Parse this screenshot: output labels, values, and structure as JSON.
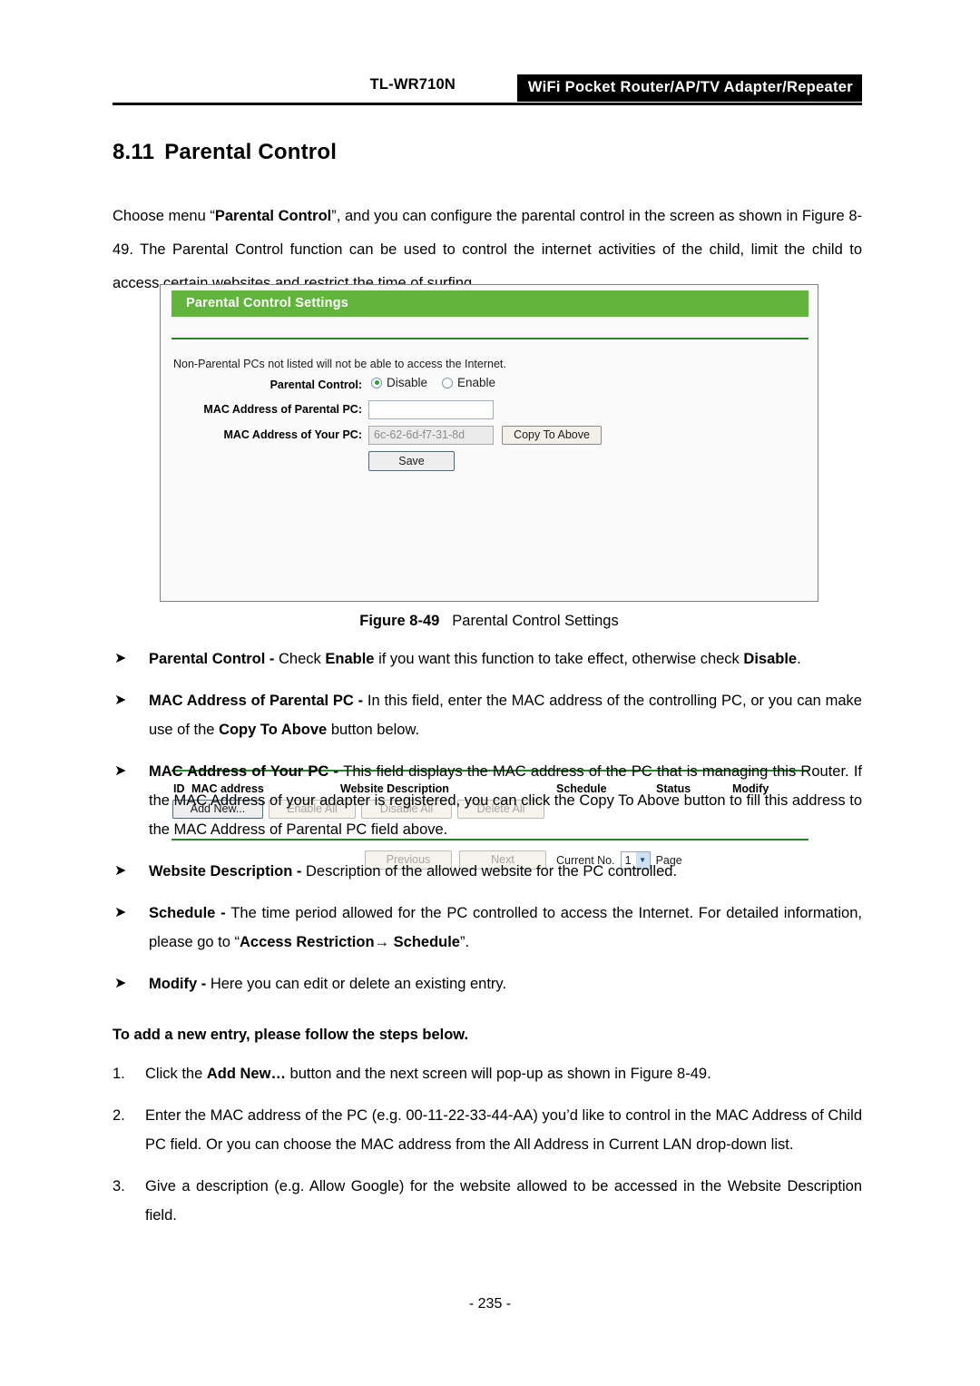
{
  "header": {
    "model": "TL-WR710N",
    "product": "WiFi Pocket Router/AP/TV Adapter/Repeater"
  },
  "section": {
    "number": "8.11",
    "title": "Parental Control"
  },
  "intro": {
    "part1": "Choose menu “",
    "bold1": "Parental Control",
    "part2": "”, and you can configure the parental control in the screen as shown in Figure 8-49. The Parental Control function can be used to control the internet activities of the child, limit the child to access certain websites and restrict the time of surfing."
  },
  "figure": {
    "caption_label": "Figure 8-49",
    "caption_text": "Parental Control Settings",
    "ui": {
      "title": "Parental Control Settings",
      "note": "Non-Parental PCs not listed will not be able to access the Internet.",
      "labels": {
        "parental_control": "Parental Control:",
        "mac_parental_pc": "MAC Address of Parental PC:",
        "mac_your_pc": "MAC Address of Your PC:"
      },
      "radios": {
        "disable": "Disable",
        "enable": "Enable",
        "selected": "Disable"
      },
      "inputs": {
        "mac_parental_value": "",
        "mac_parental_placeholder": "",
        "mac_your_pc_value": "6c-62-6d-f7-31-8d"
      },
      "buttons": {
        "copy_to_above": "Copy To Above",
        "save": "Save",
        "add_new": "Add New...",
        "enable_all": "Enable All",
        "disable_all": "Disable All",
        "delete_all": "Delete All",
        "previous": "Previous",
        "next": "Next"
      },
      "table_headers": {
        "id": "ID",
        "mac_address": "MAC address",
        "website_description": "Website Description",
        "schedule": "Schedule",
        "status": "Status",
        "modify": "Modify"
      },
      "table_rows": [],
      "pagination": {
        "prefix": "Current No.",
        "value": "1",
        "suffix": "Page",
        "options": [
          "1"
        ]
      },
      "colors": {
        "title_bar": "#62b53c",
        "rule": "#2f7d32",
        "radio_selected": "#2aa531"
      }
    }
  },
  "bullets": [
    {
      "marker": "➤",
      "segments": [
        {
          "t": "Parental Control - ",
          "b": true
        },
        {
          "t": "Check ",
          "b": false
        },
        {
          "t": "Enable",
          "b": true
        },
        {
          "t": " if you want this function to take effect, otherwise check ",
          "b": false
        },
        {
          "t": "Disable",
          "b": true
        },
        {
          "t": ".",
          "b": false
        }
      ]
    },
    {
      "marker": "➤",
      "segments": [
        {
          "t": "MAC Address of Parental PC - ",
          "b": true
        },
        {
          "t": "In this field, enter the MAC address of the controlling PC, or you can make use of the ",
          "b": false
        },
        {
          "t": "Copy To Above",
          "b": true
        },
        {
          "t": " button below.",
          "b": false
        }
      ]
    },
    {
      "marker": "➤",
      "segments": [
        {
          "t": "MAC Address of Your PC - ",
          "b": true
        },
        {
          "t": "This field displays the MAC address of the PC that is managing this Router. If the MAC Address of your adapter is registered, you can click the Copy To Above button to fill this address to the MAC Address of Parental PC field above.",
          "b": false
        }
      ]
    },
    {
      "marker": "➤",
      "segments": [
        {
          "t": "Website Description - ",
          "b": true
        },
        {
          "t": "Description of the allowed website for the PC controlled.",
          "b": false
        }
      ]
    },
    {
      "marker": "➤",
      "segments": [
        {
          "t": "Schedule - ",
          "b": true
        },
        {
          "t": "The time period allowed for the PC controlled to access the Internet. For detailed information, please go to “",
          "b": false
        },
        {
          "t": "Access Restriction→ Schedule",
          "b": true
        },
        {
          "t": "”.",
          "b": false
        }
      ]
    },
    {
      "marker": "➤",
      "segments": [
        {
          "t": "Modify - ",
          "b": true
        },
        {
          "t": "Here you can edit or delete an existing entry.",
          "b": false
        }
      ]
    }
  ],
  "steps_title": "To add a new entry, please follow the steps below.",
  "steps": [
    {
      "num": "1.",
      "segments": [
        {
          "t": "Click the ",
          "b": false
        },
        {
          "t": "Add New…",
          "b": true
        },
        {
          "t": " button and the next screen will pop-up as shown in Figure 8-49.",
          "b": false
        }
      ]
    },
    {
      "num": "2.",
      "segments": [
        {
          "t": "Enter the MAC address of the PC (e.g. 00-11-22-33-44-AA) you’d like to control in the MAC Address of Child PC field. Or you can choose the MAC address from the All Address in Current LAN drop-down list.",
          "b": false
        }
      ]
    },
    {
      "num": "3.",
      "segments": [
        {
          "t": "Give a description (e.g. Allow Google) for the website allowed to be accessed in the Website Description field.",
          "b": false
        }
      ]
    }
  ],
  "footer": {
    "page_number": "- 235 -"
  }
}
